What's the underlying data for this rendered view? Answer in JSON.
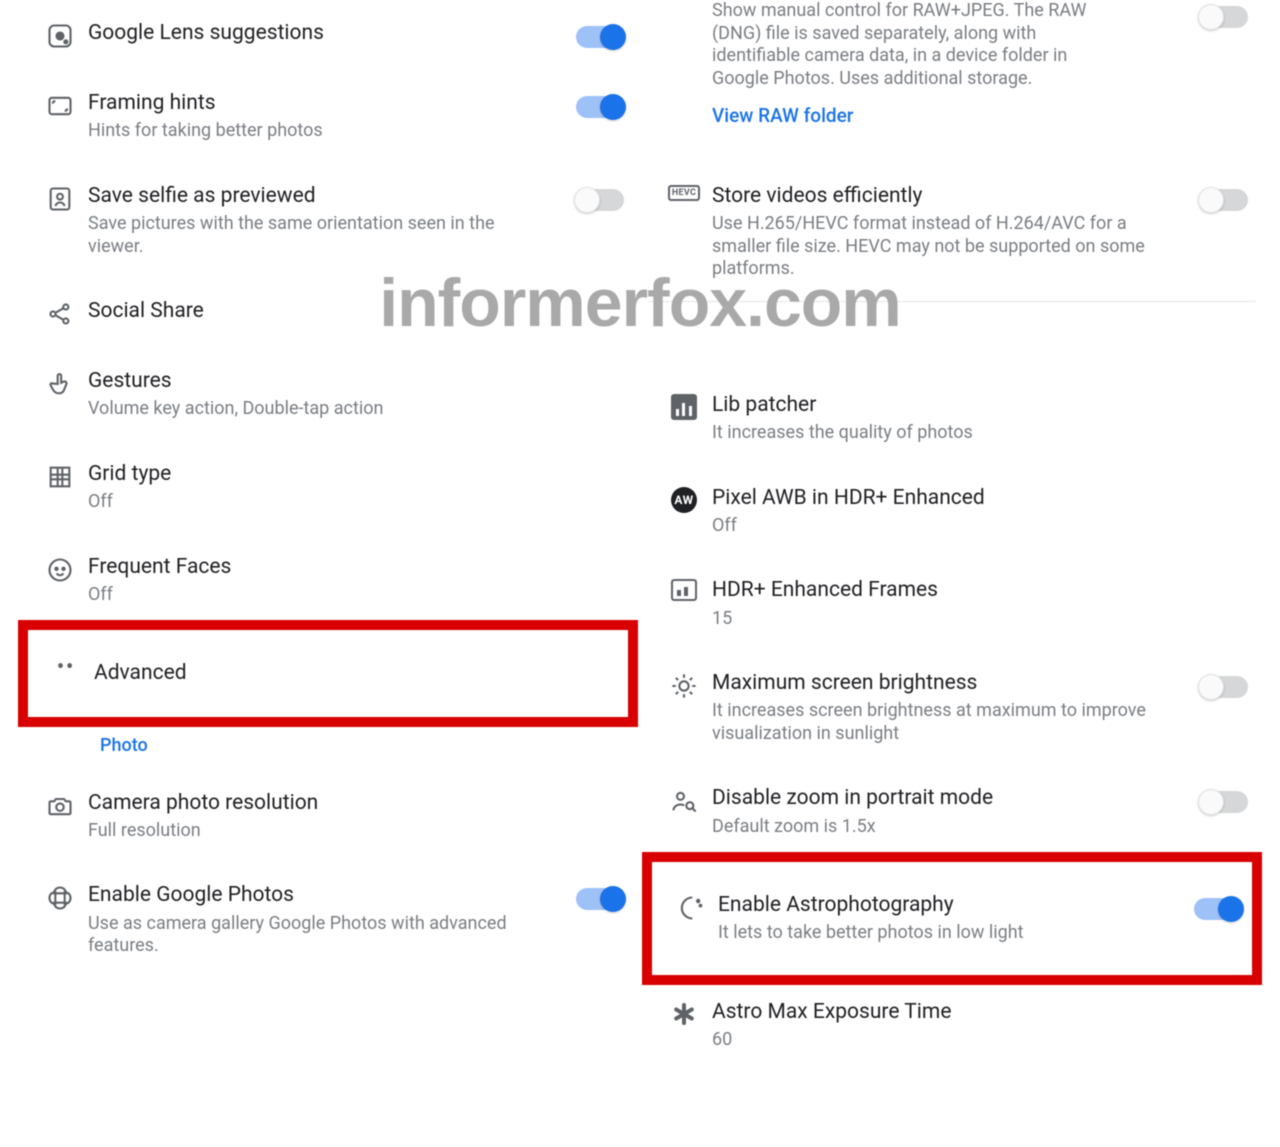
{
  "watermark": "informerfox.com",
  "left": {
    "items": [
      {
        "title": "Google Lens suggestions",
        "sub": "",
        "toggle": "on"
      },
      {
        "title": "Framing hints",
        "sub": "Hints for taking better photos",
        "toggle": "on"
      },
      {
        "title": "Save selfie as previewed",
        "sub": "Save pictures with the same orientation seen in the viewer.",
        "toggle": "off"
      },
      {
        "title": "Social Share",
        "sub": ""
      },
      {
        "title": "Gestures",
        "sub": "Volume key action, Double-tap action"
      },
      {
        "title": "Grid type",
        "sub": "Off"
      },
      {
        "title": "Frequent Faces",
        "sub": "Off"
      },
      {
        "title": "Advanced",
        "sub": ""
      }
    ],
    "section": "Photo",
    "cam": {
      "title": "Camera photo resolution",
      "sub": "Full resolution"
    },
    "gphotos": {
      "title": "Enable Google Photos",
      "sub": "Use as camera gallery Google Photos with advanced features.",
      "toggle": "on"
    }
  },
  "right": {
    "raw_partial": "Show manual control for RAW+JPEG. The RAW (DNG) file is saved separately, along with identifiable camera data, in a device folder in Google Photos. Uses additional storage.",
    "raw_link": "View RAW folder",
    "hevc": {
      "title": "Store videos efficiently",
      "sub": "Use H.265/HEVC format instead of H.264/AVC for a smaller file size. HEVC may not be supported on some platforms.",
      "toggle": "off"
    },
    "lib": {
      "title": "Lib patcher",
      "sub": "It increases the quality of photos"
    },
    "awb": {
      "title": "Pixel AWB in HDR+ Enhanced",
      "sub": "Off"
    },
    "awb_badge": "AW",
    "hdrf": {
      "title": "HDR+ Enhanced Frames",
      "sub": "15"
    },
    "bright": {
      "title": "Maximum screen brightness",
      "sub": "It increases screen brightness at maximum to improve visualization in sunlight",
      "toggle": "off"
    },
    "zoom": {
      "title": "Disable zoom in portrait mode",
      "sub": "Default zoom is 1.5x",
      "toggle": "off"
    },
    "astro": {
      "title": "Enable Astrophotography",
      "sub": "It lets to take better photos in low light",
      "toggle": "on"
    },
    "astrotime": {
      "title": "Astro Max Exposure Time",
      "sub": "60"
    },
    "hevc_badge": "HEVC"
  }
}
